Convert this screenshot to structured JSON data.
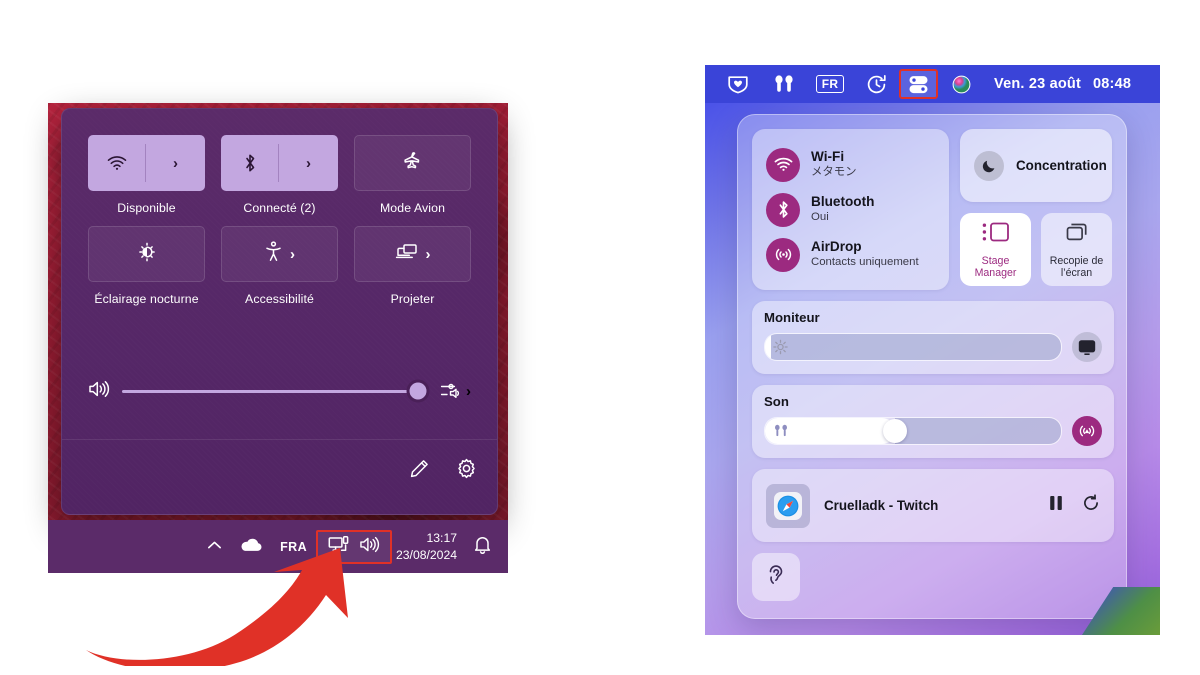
{
  "windows": {
    "quick_settings": {
      "tiles": [
        {
          "id": "wifi",
          "icon": "wifi-icon",
          "label": "Disponible",
          "state": "on",
          "has_chevron": true,
          "split": true
        },
        {
          "id": "bluetooth",
          "icon": "bluetooth-icon",
          "label": "Connecté (2)",
          "state": "on",
          "has_chevron": true,
          "split": true
        },
        {
          "id": "airplane-mode",
          "icon": "airplane-icon",
          "label": "Mode Avion",
          "state": "off",
          "has_chevron": false,
          "split": false
        },
        {
          "id": "night-light",
          "icon": "night-light-icon",
          "label": "Éclairage nocturne",
          "state": "off",
          "has_chevron": false,
          "split": false
        },
        {
          "id": "accessibility",
          "icon": "accessibility-icon",
          "label": "Accessibilité",
          "state": "off",
          "has_chevron": true,
          "split": false
        },
        {
          "id": "project",
          "icon": "project-icon",
          "label": "Projeter",
          "state": "off",
          "has_chevron": true,
          "split": false
        }
      ],
      "volume": {
        "icon": "speaker-icon",
        "value": 97,
        "output_icon": "audio-output-icon"
      },
      "footer": {
        "edit_icon": "pencil-icon",
        "settings_icon": "gear-icon"
      }
    },
    "taskbar": {
      "overflow_icon": "chevron-up-icon",
      "onedrive_icon": "cloud-icon",
      "language": "FRA",
      "network_icon": "network-monitor-icon",
      "volume_icon": "speaker-icon",
      "time": "13:17",
      "date": "23/08/2024",
      "notifications_icon": "bell-icon"
    },
    "annotation": {
      "arrow": "red-curved-arrow",
      "highlight_color": "#e03127"
    }
  },
  "macos": {
    "menubar": {
      "items": [
        {
          "id": "bitdefender",
          "icon": "shield-heart-icon"
        },
        {
          "id": "airpods",
          "icon": "airpods-icon"
        },
        {
          "id": "input-source",
          "icon": "keyboard-flag-icon",
          "label": "FR"
        },
        {
          "id": "time-machine",
          "icon": "time-machine-icon"
        },
        {
          "id": "control-center",
          "icon": "control-center-icon",
          "highlighted": true
        },
        {
          "id": "siri",
          "icon": "siri-icon"
        }
      ],
      "date": "Ven. 23 août",
      "time": "08:48"
    },
    "control_center": {
      "connectivity": [
        {
          "id": "wifi",
          "icon": "wifi-icon",
          "title": "Wi-Fi",
          "status": "メタモン"
        },
        {
          "id": "bluetooth",
          "icon": "bluetooth-icon",
          "title": "Bluetooth",
          "status": "Oui"
        },
        {
          "id": "airdrop",
          "icon": "airdrop-icon",
          "title": "AirDrop",
          "status": "Contacts uniquement"
        }
      ],
      "focus": {
        "icon": "moon-icon",
        "label": "Concentration"
      },
      "tiles": [
        {
          "id": "stage-manager",
          "icon": "stage-manager-icon",
          "label": "Stage Manager",
          "active": true
        },
        {
          "id": "screen-mirroring",
          "icon": "screen-mirroring-icon",
          "label": "Recopie de l’écran",
          "active": false
        }
      ],
      "display_slider": {
        "title": "Moniteur",
        "value": 2,
        "slider_icon": "brightness-icon",
        "side_button_icon": "display-icon"
      },
      "sound_slider": {
        "title": "Son",
        "value": 44,
        "slider_icon": "airpods-icon",
        "side_button_icon": "airplay-audio-icon"
      },
      "media": {
        "app_icon": "safari-icon",
        "title": "Cruelladk - Twitch",
        "pause_icon": "pause-icon",
        "refresh_icon": "refresh-icon"
      },
      "hearing": {
        "icon": "hearing-ear-icon"
      }
    }
  }
}
